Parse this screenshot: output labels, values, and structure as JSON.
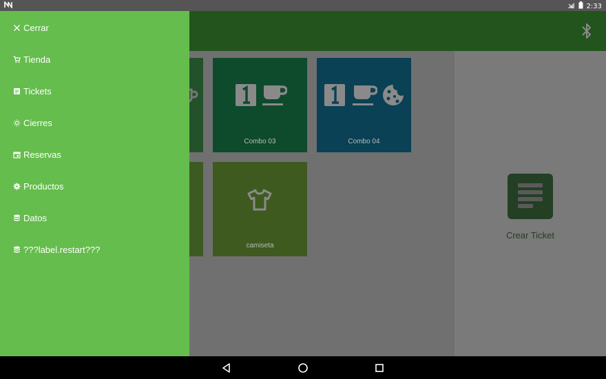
{
  "status_bar": {
    "app_icon": "notification-n-icon",
    "time": "2:33",
    "icons": [
      "no-signal-icon",
      "battery-icon"
    ]
  },
  "app_bar": {
    "color": "#24541e",
    "action_icon": "bluetooth-icon"
  },
  "drawer": {
    "background": "#64bd4c",
    "items": [
      {
        "label": "Cerrar",
        "icon": "close-icon"
      },
      {
        "label": "Tienda",
        "icon": "cart-icon"
      },
      {
        "label": "Tickets",
        "icon": "ticket-icon"
      },
      {
        "label": "Cierres",
        "icon": "sun-icon"
      },
      {
        "label": "Reservas",
        "icon": "calendar-icon"
      },
      {
        "label": "Productos",
        "icon": "gear-icon"
      },
      {
        "label": "Datos",
        "icon": "database-icon"
      },
      {
        "label": "???label.restart???",
        "icon": "database-icon"
      }
    ]
  },
  "products": [
    {
      "label": "",
      "color": "#23522a",
      "icons": [
        "coffee-cup-icon"
      ]
    },
    {
      "label": "Combo 03",
      "color": "#0e4a2c",
      "icons": [
        "number-one-icon",
        "coffee-cup-icon"
      ]
    },
    {
      "label": "Combo 04",
      "color": "#0a4154",
      "icons": [
        "number-one-icon",
        "coffee-cup-icon",
        "cookie-icon"
      ]
    },
    {
      "label": "",
      "color": "#3d5a22",
      "icons": []
    },
    {
      "label": "camiseta",
      "color": "#3e5a1f",
      "icons": [
        "tshirt-icon"
      ]
    }
  ],
  "right_panel": {
    "button_icon": "ticket-list-icon",
    "button_label": "Crear Ticket"
  },
  "nav_bar": {
    "buttons": [
      "back-icon",
      "home-icon",
      "recents-icon"
    ]
  }
}
